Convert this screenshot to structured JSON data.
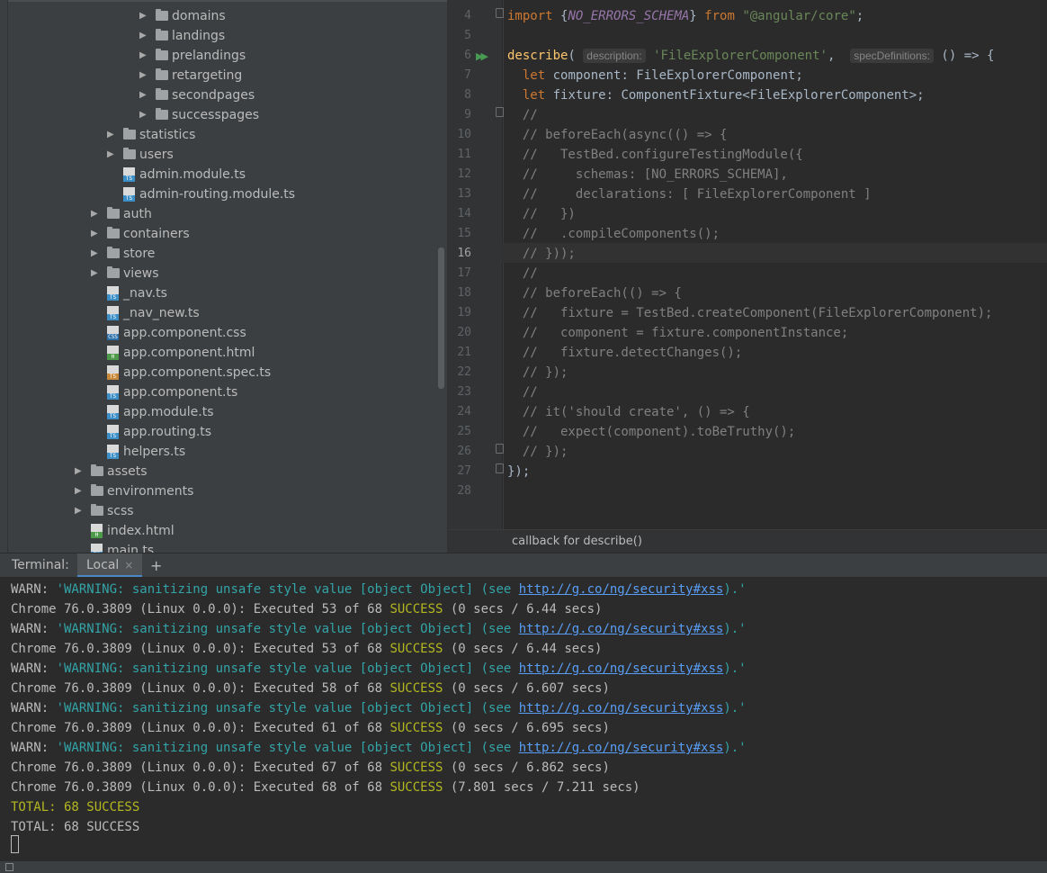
{
  "tree": {
    "items": [
      {
        "type": "folder",
        "label": "domains",
        "depth": 4,
        "collapsed": true
      },
      {
        "type": "folder",
        "label": "landings",
        "depth": 4,
        "collapsed": true
      },
      {
        "type": "folder",
        "label": "prelandings",
        "depth": 4,
        "collapsed": true
      },
      {
        "type": "folder",
        "label": "retargeting",
        "depth": 4,
        "collapsed": true
      },
      {
        "type": "folder",
        "label": "secondpages",
        "depth": 4,
        "collapsed": true
      },
      {
        "type": "folder",
        "label": "successpages",
        "depth": 4,
        "collapsed": true
      },
      {
        "type": "folder",
        "label": "statistics",
        "depth": 3,
        "collapsed": true
      },
      {
        "type": "folder",
        "label": "users",
        "depth": 3,
        "collapsed": true
      },
      {
        "type": "file",
        "label": "admin.module.ts",
        "depth": 3,
        "badge": "TS"
      },
      {
        "type": "file",
        "label": "admin-routing.module.ts",
        "depth": 3,
        "badge": "TS"
      },
      {
        "type": "folder",
        "label": "auth",
        "depth": 2,
        "collapsed": true
      },
      {
        "type": "folder",
        "label": "containers",
        "depth": 2,
        "collapsed": true
      },
      {
        "type": "folder",
        "label": "store",
        "depth": 2,
        "collapsed": true
      },
      {
        "type": "folder",
        "label": "views",
        "depth": 2,
        "collapsed": true
      },
      {
        "type": "file",
        "label": "_nav.ts",
        "depth": 2,
        "badge": "TS"
      },
      {
        "type": "file",
        "label": "_nav_new.ts",
        "depth": 2,
        "badge": "TS"
      },
      {
        "type": "file",
        "label": "app.component.css",
        "depth": 2,
        "badge": "CSS"
      },
      {
        "type": "file",
        "label": "app.component.html",
        "depth": 2,
        "badge": "H"
      },
      {
        "type": "file",
        "label": "app.component.spec.ts",
        "depth": 2,
        "badge": "TS"
      },
      {
        "type": "file",
        "label": "app.component.ts",
        "depth": 2,
        "badge": "TS"
      },
      {
        "type": "file",
        "label": "app.module.ts",
        "depth": 2,
        "badge": "TS"
      },
      {
        "type": "file",
        "label": "app.routing.ts",
        "depth": 2,
        "badge": "TS"
      },
      {
        "type": "file",
        "label": "helpers.ts",
        "depth": 2,
        "badge": "TS"
      },
      {
        "type": "folder",
        "label": "assets",
        "depth": 1,
        "collapsed": true
      },
      {
        "type": "folder",
        "label": "environments",
        "depth": 1,
        "collapsed": true
      },
      {
        "type": "folder",
        "label": "scss",
        "depth": 1,
        "collapsed": true
      },
      {
        "type": "file",
        "label": "index.html",
        "depth": 1,
        "badge": "H"
      },
      {
        "type": "file",
        "label": "main.ts",
        "depth": 1,
        "badge": "TS"
      }
    ]
  },
  "editor": {
    "current_line": "16",
    "lines": [
      {
        "n": "4",
        "html": "<span class='kw'>import</span> {<span class='imp-name'>NO_ERRORS_SCHEMA</span>} <span class='kw'>from</span> <span class='str'>\"@angular/core\"</span>;"
      },
      {
        "n": "5",
        "html": ""
      },
      {
        "n": "6",
        "html": "<span class='fn'>describe</span>( <span class='hint'>description:</span> <span class='str'>'FileExplorerComponent'</span>,  <span class='hint'>specDefinitions:</span> () => {"
      },
      {
        "n": "7",
        "html": "  <span class='kw'>let</span> <span class='ty'>component</span>: FileExplorerComponent;"
      },
      {
        "n": "8",
        "html": "  <span class='kw'>let</span> fixture: ComponentFixture&lt;FileExplorerComponent&gt;;"
      },
      {
        "n": "9",
        "html": "  <span class='cm'>//</span>"
      },
      {
        "n": "10",
        "html": "  <span class='cm'>// beforeEach(async(() => {</span>"
      },
      {
        "n": "11",
        "html": "  <span class='cm'>//   TestBed.configureTestingModule({</span>"
      },
      {
        "n": "12",
        "html": "  <span class='cm'>//     schemas: [NO_ERRORS_SCHEMA],</span>"
      },
      {
        "n": "13",
        "html": "  <span class='cm'>//     declarations: [ FileExplorerComponent ]</span>"
      },
      {
        "n": "14",
        "html": "  <span class='cm'>//   })</span>"
      },
      {
        "n": "15",
        "html": "  <span class='cm'>//   .compileComponents();</span>"
      },
      {
        "n": "16",
        "html": "  <span class='cm'>// }));</span>"
      },
      {
        "n": "17",
        "html": "  <span class='cm'>//</span>"
      },
      {
        "n": "18",
        "html": "  <span class='cm'>// beforeEach(() => {</span>"
      },
      {
        "n": "19",
        "html": "  <span class='cm'>//   fixture = TestBed.createComponent(FileExplorerComponent);</span>"
      },
      {
        "n": "20",
        "html": "  <span class='cm'>//   component = fixture.componentInstance;</span>"
      },
      {
        "n": "21",
        "html": "  <span class='cm'>//   fixture.detectChanges();</span>"
      },
      {
        "n": "22",
        "html": "  <span class='cm'>// });</span>"
      },
      {
        "n": "23",
        "html": "  <span class='cm'>//</span>"
      },
      {
        "n": "24",
        "html": "  <span class='cm'>// it('should create', () => {</span>"
      },
      {
        "n": "25",
        "html": "  <span class='cm'>//   expect(component).toBeTruthy();</span>"
      },
      {
        "n": "26",
        "html": "  <span class='cm'>// });</span>"
      },
      {
        "n": "27",
        "html": "});"
      },
      {
        "n": "28",
        "html": ""
      }
    ],
    "breadcrumb": "callback for describe()"
  },
  "terminal": {
    "title": "Terminal:",
    "tab_label": "Local",
    "close_glyph": "×",
    "add_glyph": "+",
    "lines": [
      {
        "kind": "warn",
        "prefix": "WARN: ",
        "msg": "'WARNING: sanitizing unsafe style value [object Object] (see ",
        "link": "http://g.co/ng/security#xss",
        "tail": ").'"
      },
      {
        "kind": "exec",
        "pre": "Chrome 76.0.3809 (Linux 0.0.0): Executed 53 of 68 ",
        "succ": "SUCCESS",
        "post": " (0 secs / 6.44 secs)"
      },
      {
        "kind": "warn",
        "prefix": "WARN: ",
        "msg": "'WARNING: sanitizing unsafe style value [object Object] (see ",
        "link": "http://g.co/ng/security#xss",
        "tail": ").'"
      },
      {
        "kind": "exec",
        "pre": "Chrome 76.0.3809 (Linux 0.0.0): Executed 53 of 68 ",
        "succ": "SUCCESS",
        "post": " (0 secs / 6.44 secs)"
      },
      {
        "kind": "warn",
        "prefix": "WARN: ",
        "msg": "'WARNING: sanitizing unsafe style value [object Object] (see ",
        "link": "http://g.co/ng/security#xss",
        "tail": ").'"
      },
      {
        "kind": "exec",
        "pre": "Chrome 76.0.3809 (Linux 0.0.0): Executed 58 of 68 ",
        "succ": "SUCCESS",
        "post": " (0 secs / 6.607 secs)"
      },
      {
        "kind": "warn",
        "prefix": "WARN: ",
        "msg": "'WARNING: sanitizing unsafe style value [object Object] (see ",
        "link": "http://g.co/ng/security#xss",
        "tail": ").'"
      },
      {
        "kind": "exec",
        "pre": "Chrome 76.0.3809 (Linux 0.0.0): Executed 61 of 68 ",
        "succ": "SUCCESS",
        "post": " (0 secs / 6.695 secs)"
      },
      {
        "kind": "warn",
        "prefix": "WARN: ",
        "msg": "'WARNING: sanitizing unsafe style value [object Object] (see ",
        "link": "http://g.co/ng/security#xss",
        "tail": ").'"
      },
      {
        "kind": "exec",
        "pre": "Chrome 76.0.3809 (Linux 0.0.0): Executed 67 of 68 ",
        "succ": "SUCCESS",
        "post": " (0 secs / 6.862 secs)"
      },
      {
        "kind": "exec",
        "pre": "Chrome 76.0.3809 (Linux 0.0.0): Executed 68 of 68 ",
        "succ": "SUCCESS",
        "post": " (7.801 secs / 7.211 secs)"
      },
      {
        "kind": "total",
        "text": "TOTAL: 68 SUCCESS",
        "color": "#b4b820"
      },
      {
        "kind": "plain",
        "text": "TOTAL: 68 SUCCESS"
      }
    ]
  },
  "colors": {
    "ts_badge": "#3d8fc7",
    "css_badge": "#2d6fa8",
    "html_badge": "#4c9a4a",
    "spec_badge": "#c9893a"
  }
}
